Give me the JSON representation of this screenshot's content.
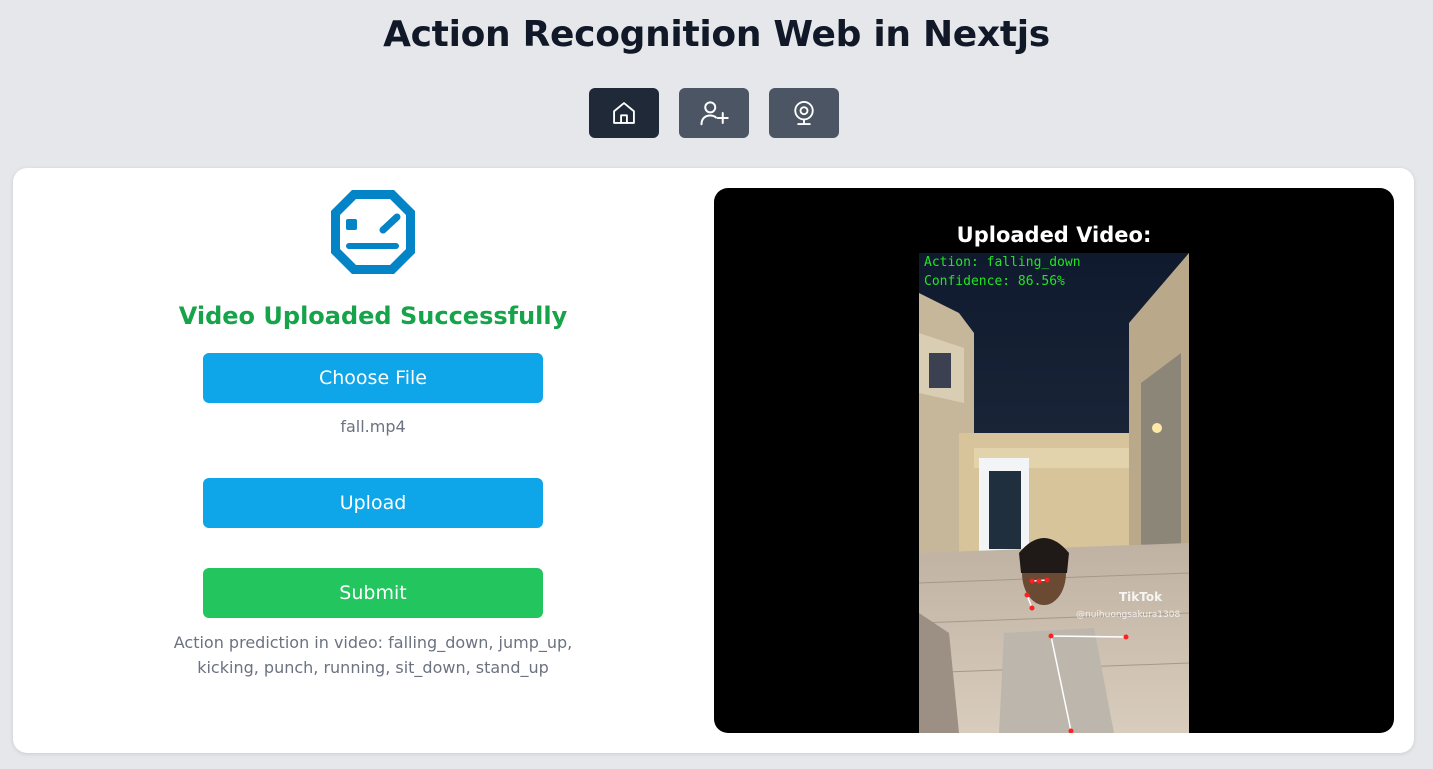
{
  "header": {
    "title": "Action Recognition Web in Nextjs"
  },
  "nav": {
    "items": [
      {
        "name": "home",
        "icon": "home-icon",
        "active": true
      },
      {
        "name": "add-user",
        "icon": "user-plus-icon",
        "active": false
      },
      {
        "name": "webcam",
        "icon": "webcam-icon",
        "active": false
      }
    ]
  },
  "upload": {
    "status": "Video Uploaded Successfully",
    "choose_label": "Choose File",
    "filename": "fall.mp4",
    "upload_label": "Upload",
    "submit_label": "Submit",
    "hint": "Action prediction in video: falling_down, jump_up, kicking, punch, running, sit_down, stand_up"
  },
  "video": {
    "title": "Uploaded Video:",
    "overlay_action": "Action: falling_down",
    "overlay_confidence": "Confidence: 86.56%",
    "watermark": "TikTok",
    "watermark_user": "@nuihuongsakura1308"
  },
  "colors": {
    "success": "#16a34a",
    "primary_button": "#0ea5e9",
    "submit_button": "#22c55e",
    "nav_active": "#1f2937",
    "nav_default": "#4b5563",
    "logo": "#0284c7"
  }
}
